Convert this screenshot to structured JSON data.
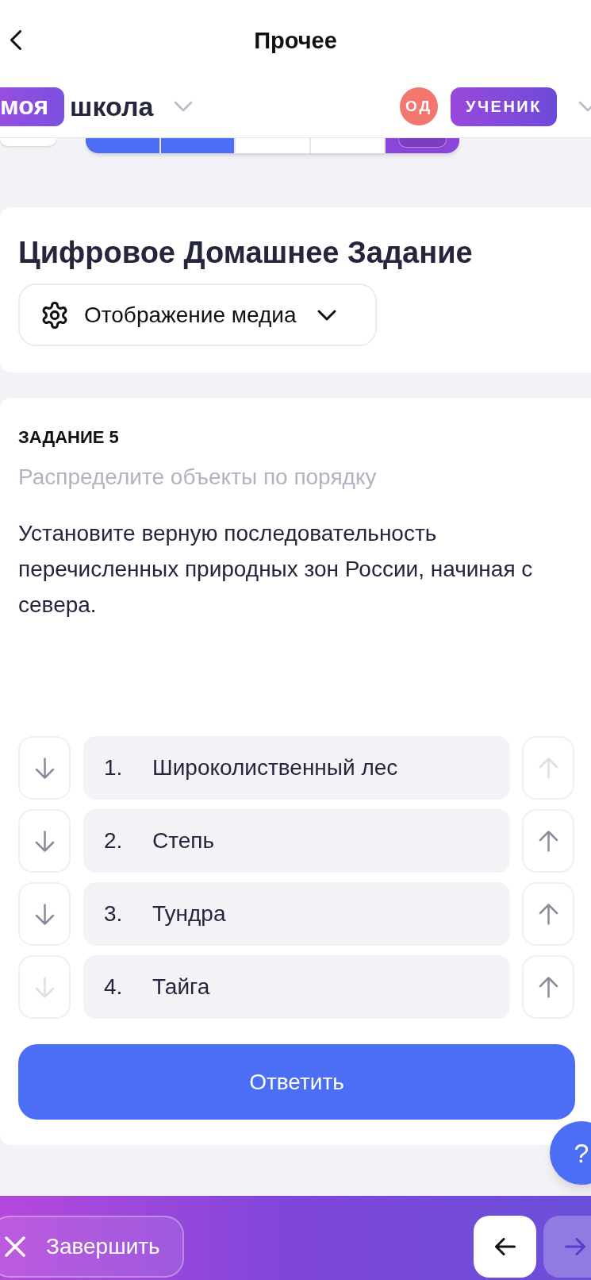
{
  "top_bar": {
    "title": "Прочее"
  },
  "school_bar": {
    "logo_badge": "моя",
    "logo_text": "школа",
    "avatar_initials": "ОД",
    "role": "УЧЕНИК"
  },
  "progress_strip": {
    "segments": [
      {
        "color": "#4b6ef5",
        "selected": false
      },
      {
        "color": "#4b6ef5",
        "selected": false
      },
      {
        "color": "#ffffff",
        "selected": false
      },
      {
        "color": "#ffffff",
        "selected": false
      },
      {
        "color": "#8b45da",
        "selected": true
      }
    ]
  },
  "title_card": {
    "title": "Цифровое Домашнее Задание",
    "media_dropdown": {
      "label": "Отображение медиа"
    }
  },
  "task": {
    "number_label": "ЗАДАНИЕ 5",
    "instruction": "Распределите объекты по порядку",
    "question": "Установите верную последовательность перечисленных природных зон России, начиная с севера.",
    "items": [
      {
        "number": "1.",
        "text": "Широколиственный лес",
        "up_disabled": true,
        "down_disabled": false
      },
      {
        "number": "2.",
        "text": "Степь",
        "up_disabled": false,
        "down_disabled": false
      },
      {
        "number": "3.",
        "text": "Тундра",
        "up_disabled": false,
        "down_disabled": false
      },
      {
        "number": "4.",
        "text": "Тайга",
        "up_disabled": false,
        "down_disabled": true
      }
    ],
    "submit_button": "Ответить"
  },
  "help_button": {
    "label": "?"
  },
  "bottom_bar": {
    "finish_button": {
      "label": "Завершить"
    },
    "prev_button": {
      "disabled": false
    },
    "next_button": {
      "disabled": true
    }
  }
}
